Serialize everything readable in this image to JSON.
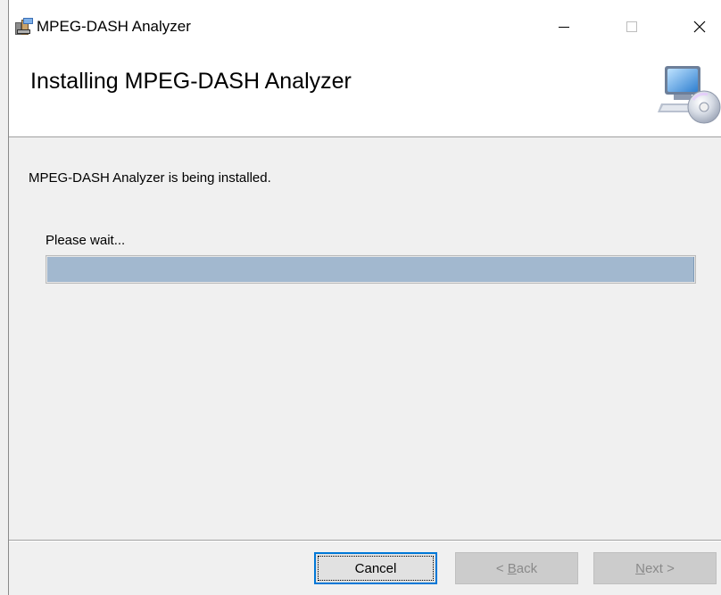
{
  "window": {
    "title": "MPEG-DASH Analyzer"
  },
  "banner": {
    "title": "Installing MPEG-DASH Analyzer"
  },
  "body": {
    "status_text": "MPEG-DASH Analyzer is being installed.",
    "wait_text": "Please wait...",
    "progress_fraction": 1.0
  },
  "buttons": {
    "cancel": {
      "label": "Cancel",
      "enabled": true
    },
    "back": {
      "mnemonic": "B",
      "rest": "ack",
      "prefix": "< ",
      "enabled": false
    },
    "next": {
      "mnemonic": "N",
      "rest": "ext",
      "suffix": " >",
      "enabled": false
    }
  },
  "icons": {
    "app": "installer-package-icon",
    "banner": "computer-cd-icon",
    "minimize": "minimize-icon",
    "maximize": "maximize-icon",
    "close": "close-icon"
  },
  "colors": {
    "progress_fill": "#a2b8cf",
    "focus_border": "#0078d7"
  }
}
